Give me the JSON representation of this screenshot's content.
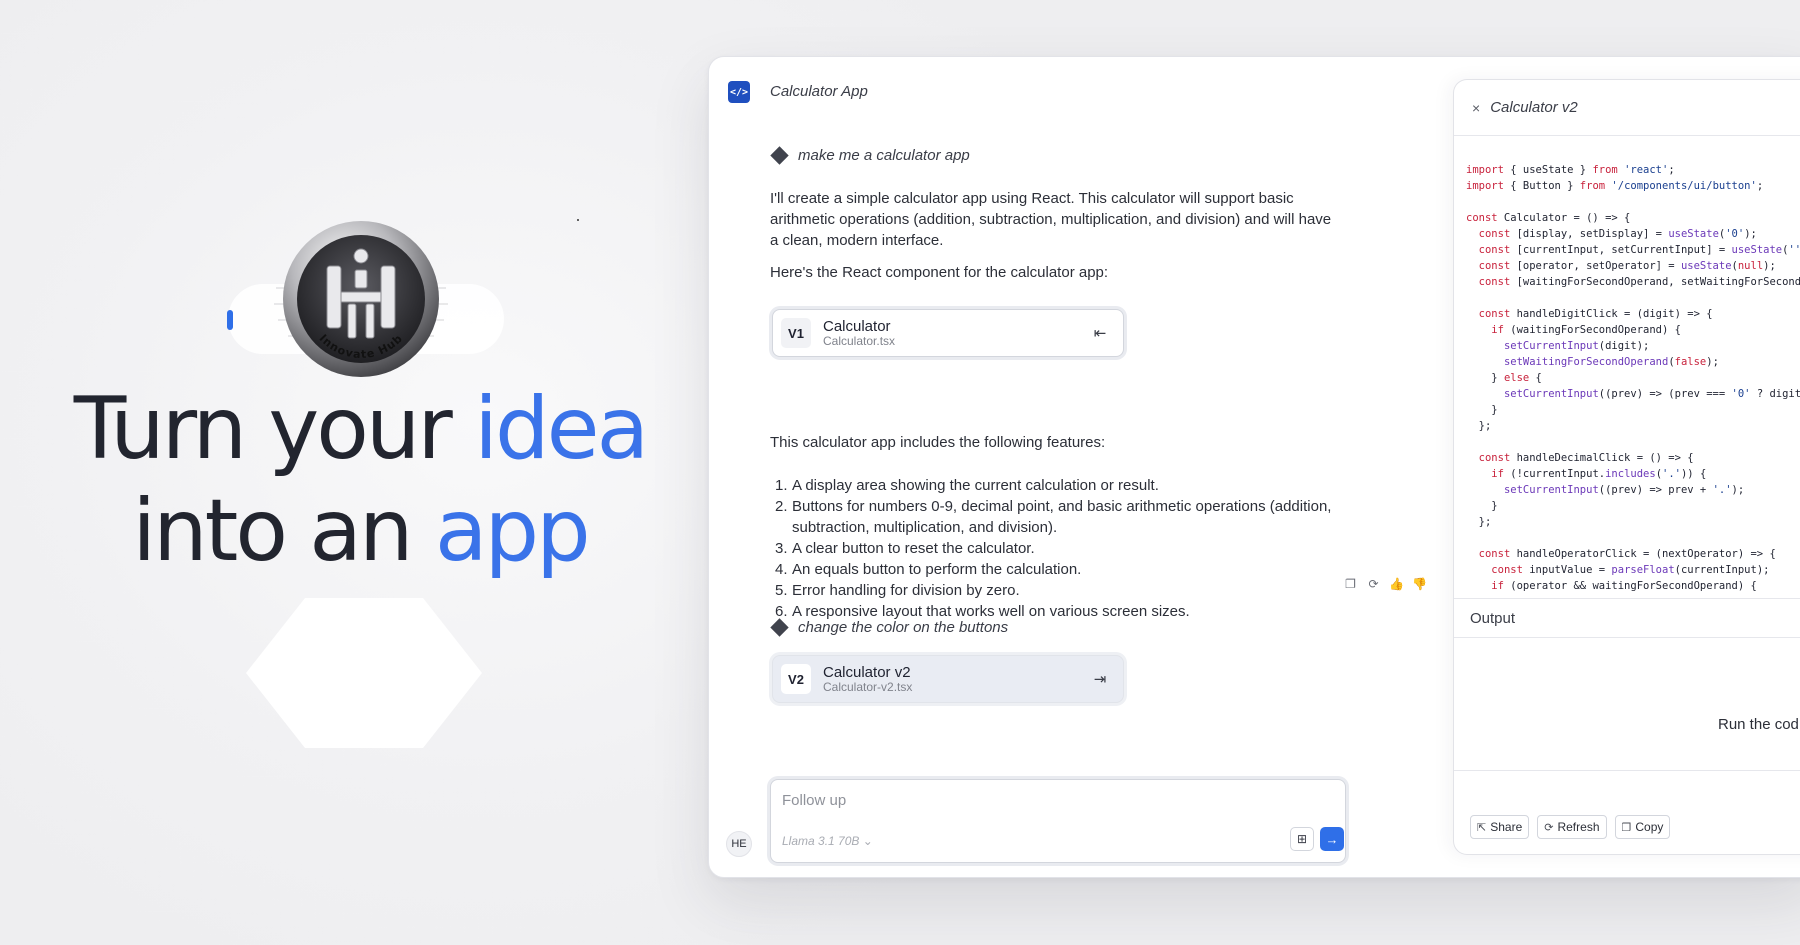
{
  "hero": {
    "line1_prefix": "Turn your ",
    "line1_accent": "idea",
    "line2_prefix": "into an ",
    "line2_accent": "app",
    "accent_color": "#3a73e9",
    "logo_text": "Innovate Hub"
  },
  "app": {
    "title": "Calculator App",
    "icon": "code-icon",
    "chat": {
      "prompt1": "make me a calculator app",
      "response_intro": "I'll create a simple calculator app using React. This calculator will support basic arithmetic operations (addition, subtraction, multiplication, and division) and will have a clean, modern interface.",
      "response_component": "Here's the React component for the calculator app:",
      "artifact1": {
        "badge": "V1",
        "name": "Calculator",
        "file": "Calculator.tsx",
        "arrow": "⇤"
      },
      "features_intro": "This calculator app includes the following features:",
      "features": [
        {
          "num": "1.",
          "text": "A display area showing the current calculation or result."
        },
        {
          "num": "2.",
          "text": "Buttons for numbers 0-9, decimal point, and basic arithmetic operations (addition, subtraction, multiplication, and division)."
        },
        {
          "num": "3.",
          "text": "A clear button to reset the calculator."
        },
        {
          "num": "4.",
          "text": "An equals button to perform the calculation."
        },
        {
          "num": "5.",
          "text": "Error handling for division by zero."
        },
        {
          "num": "6.",
          "text": "A responsive layout that works well on various screen sizes."
        }
      ],
      "prompt2": "change the color on the buttons",
      "artifact2": {
        "badge": "V2",
        "name": "Calculator v2",
        "file": "Calculator-v2.tsx",
        "arrow": "⇥"
      }
    },
    "followup": {
      "placeholder": "Follow up",
      "model": "Llama 3.1 70B ⌄",
      "send_icon": "arrow-right-icon",
      "image_icon": "image-add-icon"
    },
    "user_avatar": "HE"
  },
  "panel": {
    "close": "×",
    "title": "Calculator v2",
    "output_title": "Output",
    "run_text": "Run the cod",
    "buttons": {
      "share": "Share",
      "refresh": "Refresh",
      "copy": "Copy"
    }
  },
  "colors": {
    "brand_blue": "#2f6fe8",
    "app_icon_bg": "#1f4fbf"
  }
}
